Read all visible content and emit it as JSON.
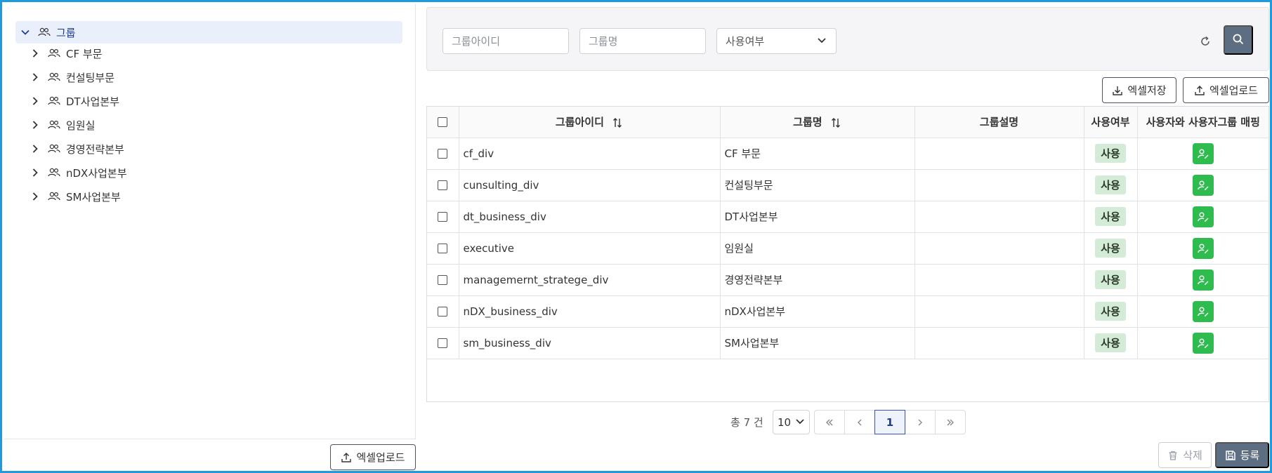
{
  "tree": {
    "root": {
      "label": "그룹",
      "icon": "users-icon"
    },
    "children": [
      {
        "label": "CF 부문"
      },
      {
        "label": "컨설팅부문"
      },
      {
        "label": "DT사업본부"
      },
      {
        "label": "임원실"
      },
      {
        "label": "경영전략본부"
      },
      {
        "label": "nDX사업본부"
      },
      {
        "label": "SM사업본부"
      }
    ]
  },
  "left_panel": {
    "excel_upload_label": "엑셀업로드"
  },
  "search": {
    "group_id_placeholder": "그룹아이디",
    "group_name_placeholder": "그룹명",
    "use_status_placeholder": "사용여부"
  },
  "toolbar": {
    "excel_save_label": "엑셀저장",
    "excel_upload_label": "엑셀업로드"
  },
  "table": {
    "headers": {
      "group_id": "그룹아이디",
      "group_name": "그룹명",
      "group_desc": "그룹설명",
      "use_status": "사용여부",
      "mapping": "사용자와 사용자그룹 매핑"
    },
    "rows": [
      {
        "group_id": "cf_div",
        "group_name": "CF 부문",
        "group_desc": "",
        "use_status": "사용"
      },
      {
        "group_id": "cunsulting_div",
        "group_name": "컨설팅부문",
        "group_desc": "",
        "use_status": "사용"
      },
      {
        "group_id": "dt_business_div",
        "group_name": "DT사업본부",
        "group_desc": "",
        "use_status": "사용"
      },
      {
        "group_id": "executive",
        "group_name": "임원실",
        "group_desc": "",
        "use_status": "사용"
      },
      {
        "group_id": "managemernt_stratege_div",
        "group_name": "경영전략본부",
        "group_desc": "",
        "use_status": "사용"
      },
      {
        "group_id": "nDX_business_div",
        "group_name": "nDX사업본부",
        "group_desc": "",
        "use_status": "사용"
      },
      {
        "group_id": "sm_business_div",
        "group_name": "SM사업본부",
        "group_desc": "",
        "use_status": "사용"
      }
    ]
  },
  "pagination": {
    "total_text": "총 7 건",
    "page_size": "10",
    "current_page": "1"
  },
  "actions": {
    "delete_label": "삭제",
    "register_label": "등록"
  },
  "colors": {
    "frame_border": "#1e9be0",
    "primary": "#5e6e82",
    "map_button": "#2ebc4f",
    "badge_bg": "#d4ecd7",
    "tree_selected_bg": "#eaf0fb"
  }
}
